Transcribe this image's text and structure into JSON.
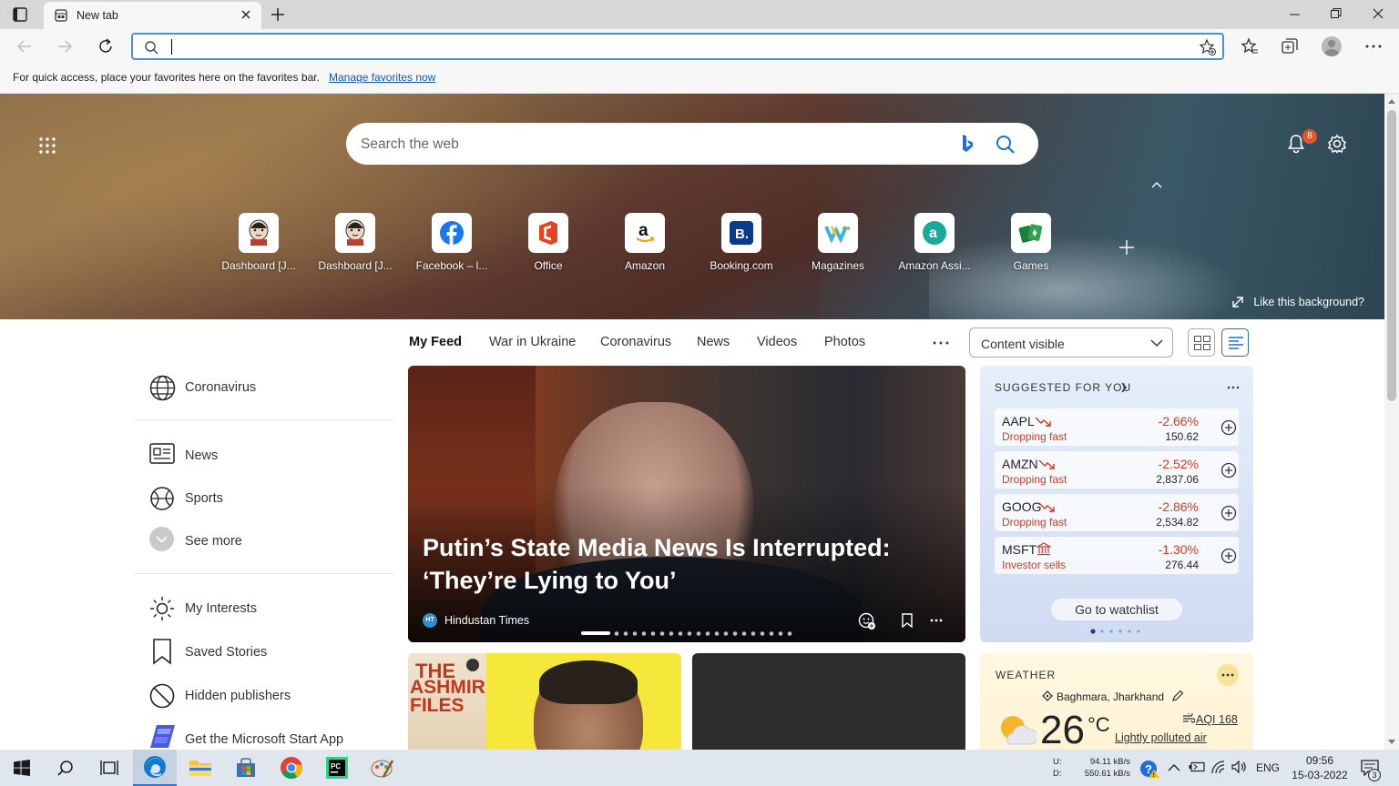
{
  "browser": {
    "tab_title": "New tab",
    "favorites_bar_message": "For quick access, place your favorites here on the favorites bar.",
    "favorites_bar_link": "Manage favorites now",
    "address_value": ""
  },
  "hero": {
    "search_placeholder": "Search the web",
    "notification_count": "8",
    "like_background": "Like this background?",
    "quick_links": [
      {
        "label": "Dashboard [J...",
        "icon": "jenkins-icon"
      },
      {
        "label": "Dashboard [J...",
        "icon": "jenkins-icon"
      },
      {
        "label": "Facebook – l...",
        "icon": "facebook-icon"
      },
      {
        "label": "Office",
        "icon": "office-icon"
      },
      {
        "label": "Amazon",
        "icon": "amazon-icon"
      },
      {
        "label": "Booking.com",
        "icon": "booking-icon"
      },
      {
        "label": "Magazines",
        "icon": "magazines-icon"
      },
      {
        "label": "Amazon Assi...",
        "icon": "amazon-assistant-icon"
      },
      {
        "label": "Games",
        "icon": "games-icon"
      }
    ]
  },
  "feed_nav": {
    "tabs": [
      "My Feed",
      "War in Ukraine",
      "Coronavirus",
      "News",
      "Videos",
      "Photos"
    ],
    "content_select": "Content visible"
  },
  "sidebar": {
    "items": [
      {
        "label": "Coronavirus",
        "icon": "globe-icon"
      },
      {
        "label": "News",
        "icon": "newspaper-icon"
      },
      {
        "label": "Sports",
        "icon": "ball-icon"
      },
      {
        "label": "See more",
        "icon": "chevron-down-icon"
      },
      {
        "label": "My Interests",
        "icon": "sun-icon"
      },
      {
        "label": "Saved Stories",
        "icon": "bookmark-icon"
      },
      {
        "label": "Hidden publishers",
        "icon": "block-icon"
      },
      {
        "label": "Get the Microsoft Start App",
        "icon": "microsoft-start-icon"
      }
    ]
  },
  "main_story": {
    "headline": "Putin’s State Media News Is Interrupted: ‘They’re Lying to You’",
    "source": "Hindustan Times",
    "source_badge": "HT"
  },
  "stocks": {
    "title": "SUGGESTED FOR YOU",
    "items": [
      {
        "symbol": "AAPL",
        "note": "Dropping fast",
        "change": "-2.66%",
        "price": "150.62"
      },
      {
        "symbol": "AMZN",
        "note": "Dropping fast",
        "change": "-2.52%",
        "price": "2,837.06"
      },
      {
        "symbol": "GOOG",
        "note": "Dropping fast",
        "change": "-2.86%",
        "price": "2,534.82"
      },
      {
        "symbol": "MSFT",
        "note": "Investor sells",
        "change": "-1.30%",
        "price": "276.44"
      }
    ],
    "watchlist_button": "Go to watchlist"
  },
  "weather": {
    "title": "WEATHER",
    "location": "Baghmara, Jharkhand",
    "temperature": "26",
    "unit": "°C",
    "aqi": "AQI 168",
    "air_quality": "Lightly polluted air"
  },
  "thumb_card": {
    "text": "ASHMIR FILES",
    "text_top": "THE"
  },
  "taskbar": {
    "net_up": "94.11 kB/s",
    "net_down": "550.61 kB/s",
    "net_up_label": "U:",
    "net_down_label": "D:",
    "language": "ENG",
    "time": "09:56",
    "date": "15-03-2022",
    "notification_count": "3"
  },
  "colors": {
    "accent": "#0a59b8",
    "stock_down": "#d03a1e",
    "taskbar": "#dfe6ee"
  }
}
